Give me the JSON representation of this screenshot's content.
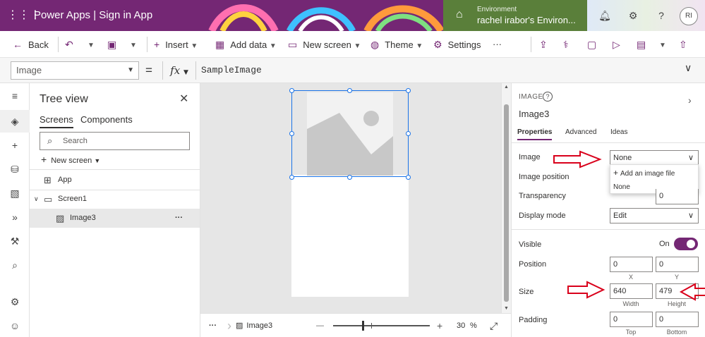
{
  "titlebar": {
    "app_title": "Power Apps  |  Sign in App",
    "environment_label": "Environment",
    "environment_name": "rachel irabor's Environ...",
    "avatar_initials": "RI"
  },
  "commandbar": {
    "back": "Back",
    "insert": "Insert",
    "add_data": "Add data",
    "new_screen": "New screen",
    "theme": "Theme",
    "settings": "Settings",
    "more": "···"
  },
  "formulabar": {
    "property": "Image",
    "equals": "=",
    "fx": "fx",
    "formula": "SampleImage"
  },
  "tree": {
    "title": "Tree view",
    "tabs": [
      "Screens",
      "Components"
    ],
    "search_placeholder": "Search",
    "new_screen": "New screen",
    "nodes": [
      {
        "label": "App"
      },
      {
        "label": "Screen1"
      },
      {
        "label": "Image3"
      }
    ],
    "more": "···"
  },
  "statusbar": {
    "more": "···",
    "selected": "Image3",
    "zoom_minus": "—",
    "zoom_plus": "+",
    "zoom_value": "30",
    "zoom_unit": "%",
    "zoom_fraction": 0.3
  },
  "properties": {
    "kind": "IMAGE",
    "control_name": "Image3",
    "tabs": [
      "Properties",
      "Advanced",
      "Ideas"
    ],
    "image_label": "Image",
    "image_value": "None",
    "menu_add": "Add an image file",
    "menu_none": "None",
    "image_position_label": "Image position",
    "transparency_label": "Transparency",
    "transparency_value": "0",
    "display_mode_label": "Display mode",
    "display_mode_value": "Edit",
    "visible_label": "Visible",
    "visible_value": "On",
    "position_label": "Position",
    "x_value": "0",
    "y_value": "0",
    "x_sub": "X",
    "y_sub": "Y",
    "size_label": "Size",
    "width_value": "640",
    "height_value": "479",
    "width_sub": "Width",
    "height_sub": "Height",
    "padding_label": "Padding",
    "pad_top_value": "0",
    "pad_bottom_value": "0",
    "top_sub": "Top",
    "bottom_sub": "Bottom"
  },
  "colors": {
    "brand": "#742774",
    "environment_bg": "#5a7f3a",
    "selection": "#1a73e8",
    "annotation_arrow": "#d9001b"
  }
}
